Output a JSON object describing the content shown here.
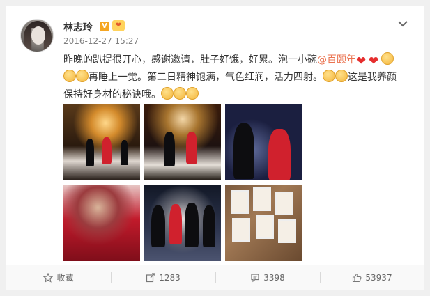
{
  "post": {
    "username": "林志玲",
    "verified_badge": "V",
    "member_badge": "❤",
    "timestamp": "2016-12-27 15:27",
    "text_line1_a": "昨晚的趴提很开心，感谢邀请，肚子好饿，好累。泡一小碗",
    "mention": "@百颐年",
    "text_line2_a": "再睡上一觉。第二日精神饱满，气色红润，活力四射。",
    "text_line2_b": "这是我养颜",
    "text_line3": "保持好身材的秘诀哦。"
  },
  "icons": {
    "menu": "chevron-down-icon",
    "favorite": "star-icon",
    "repost": "share-icon",
    "comment": "comment-icon",
    "like": "thumbs-up-icon"
  },
  "actions": {
    "favorite_label": "收藏",
    "repost_count": "1283",
    "comment_count": "3398",
    "like_count": "53937"
  },
  "colors": {
    "mention": "#eb7350",
    "heart": "#e62e2e",
    "badge_v": "#f5a623"
  }
}
